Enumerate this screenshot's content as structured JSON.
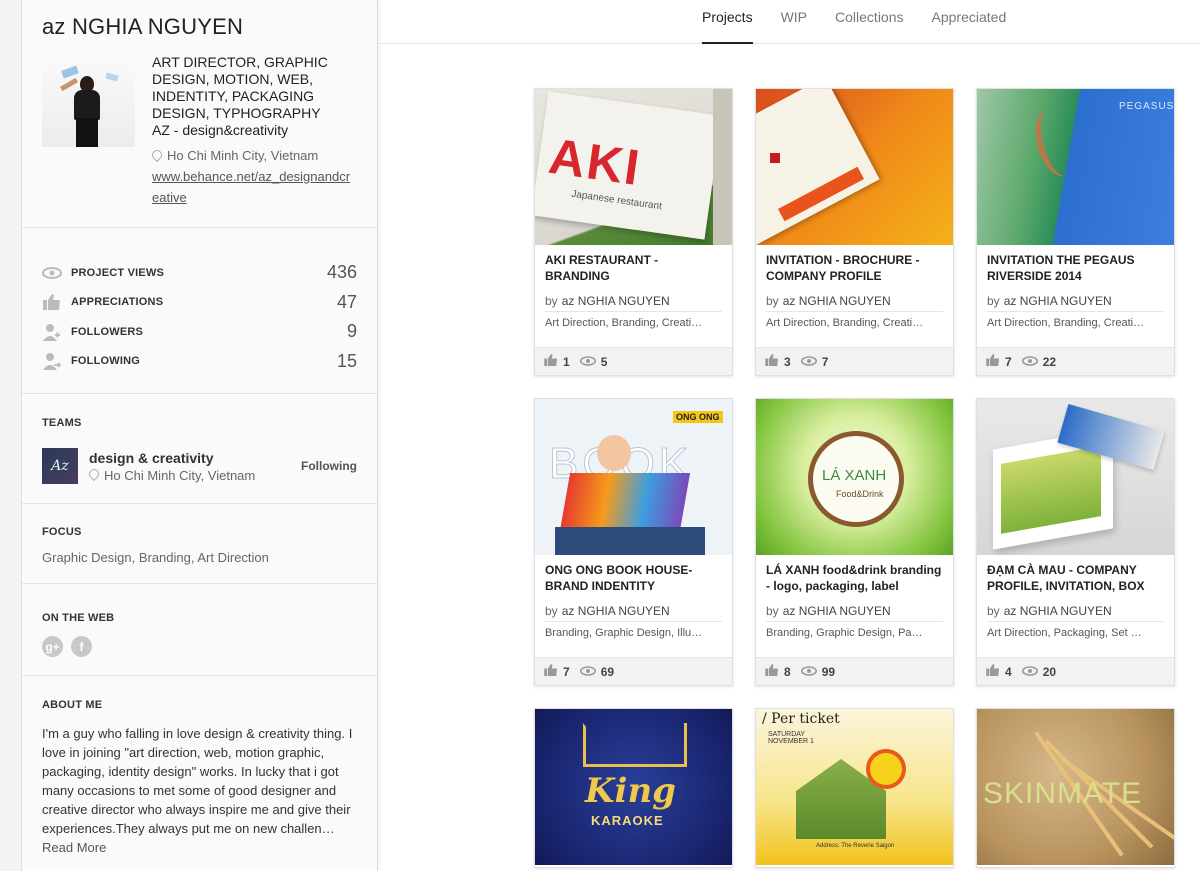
{
  "profile": {
    "name": "az NGHIA NGUYEN",
    "title": "ART DIRECTOR, GRAPHIC DESIGN, MOTION, WEB, INDENTITY, PACKAGING DESIGN, TYPHOGRAPHY",
    "company": "AZ - design&creativity",
    "location": "Ho Chi Minh City, Vietnam",
    "website": "www.behance.net/az_designandcreative"
  },
  "stats": [
    {
      "label": "PROJECT VIEWS",
      "value": "436",
      "icon": "eye-icon"
    },
    {
      "label": "APPRECIATIONS",
      "value": "47",
      "icon": "thumbs-up-icon"
    },
    {
      "label": "FOLLOWERS",
      "value": "9",
      "icon": "followers-icon"
    },
    {
      "label": "FOLLOWING",
      "value": "15",
      "icon": "following-icon"
    }
  ],
  "teams": {
    "title": "TEAMS",
    "items": [
      {
        "name": "design & creativity",
        "location": "Ho Chi Minh City, Vietnam",
        "status": "Following",
        "logo_text": "Az"
      }
    ]
  },
  "focus": {
    "title": "FOCUS",
    "text": "Graphic Design, Branding, Art Direction"
  },
  "web": {
    "title": "ON THE WEB",
    "icons": [
      {
        "name": "google-plus-icon",
        "glyph": "g+"
      },
      {
        "name": "facebook-icon",
        "glyph": "f"
      }
    ]
  },
  "about": {
    "title": "ABOUT ME",
    "text": "I'm a guy who falling in love design & creativity thing. I love in joining \"art direction, web, motion graphic, packaging, identity design\" works. In lucky that i got many occasions to met some of good designer and creative director who always inspire me and give their experiences.They always put me on new challen…",
    "read_more": "Read More"
  },
  "tabs": [
    {
      "label": "Projects",
      "active": true
    },
    {
      "label": "WIP",
      "active": false
    },
    {
      "label": "Collections",
      "active": false
    },
    {
      "label": "Appreciated",
      "active": false
    }
  ],
  "projects": [
    {
      "title": "AKI RESTAURANT - BRANDING",
      "by": "by",
      "owner": "az NGHIA NGUYEN",
      "fields": "Art Direction, Branding, Creati…",
      "appreciations": "1",
      "views": "5",
      "thumb_text": "AKI",
      "thumb_sub": "Japanese restaurant"
    },
    {
      "title": "INVITATION - BROCHURE - COMPANY PROFILE",
      "by": "by",
      "owner": "az NGHIA NGUYEN",
      "fields": "Art Direction, Branding, Creati…",
      "appreciations": "3",
      "views": "7"
    },
    {
      "title": "INVITATION THE PEGAUS RIVERSIDE 2014",
      "by": "by",
      "owner": "az NGHIA NGUYEN",
      "fields": "Art Direction, Branding, Creati…",
      "appreciations": "7",
      "views": "22",
      "thumb_text": "PEGASUS"
    },
    {
      "title": "ONG ONG BOOK HOUSE- BRAND INDENTITY",
      "by": "by",
      "owner": "az NGHIA NGUYEN",
      "fields": "Branding, Graphic Design, Illu…",
      "appreciations": "7",
      "views": "69",
      "thumb_text": "BOOK",
      "thumb_sub": "ONG ONG"
    },
    {
      "title": "LÁ XANH food&drink branding - logo, packaging, label",
      "by": "by",
      "owner": "az NGHIA NGUYEN",
      "fields": "Branding, Graphic Design, Pa…",
      "appreciations": "8",
      "views": "99",
      "thumb_text": "LÁ XANH",
      "thumb_sub": "Food&Drink"
    },
    {
      "title": "ĐẠM CÀ MAU - COMPANY PROFILE, INVITATION, BOX",
      "by": "by",
      "owner": "az NGHIA NGUYEN",
      "fields": "Art Direction, Packaging, Set …",
      "appreciations": "4",
      "views": "20"
    },
    {
      "thumb_text": "King",
      "thumb_sub": "KARAOKE"
    },
    {
      "thumb_text": "/ Per ticket",
      "thumb_sub": "SATURDAY NOVEMBER 1",
      "thumb_extra": "Address: The Reverie Saigon"
    },
    {
      "thumb_text": "SKINMATE"
    }
  ],
  "colors": {
    "accent": "#222222",
    "sidebar_bg": "#fafafa"
  }
}
